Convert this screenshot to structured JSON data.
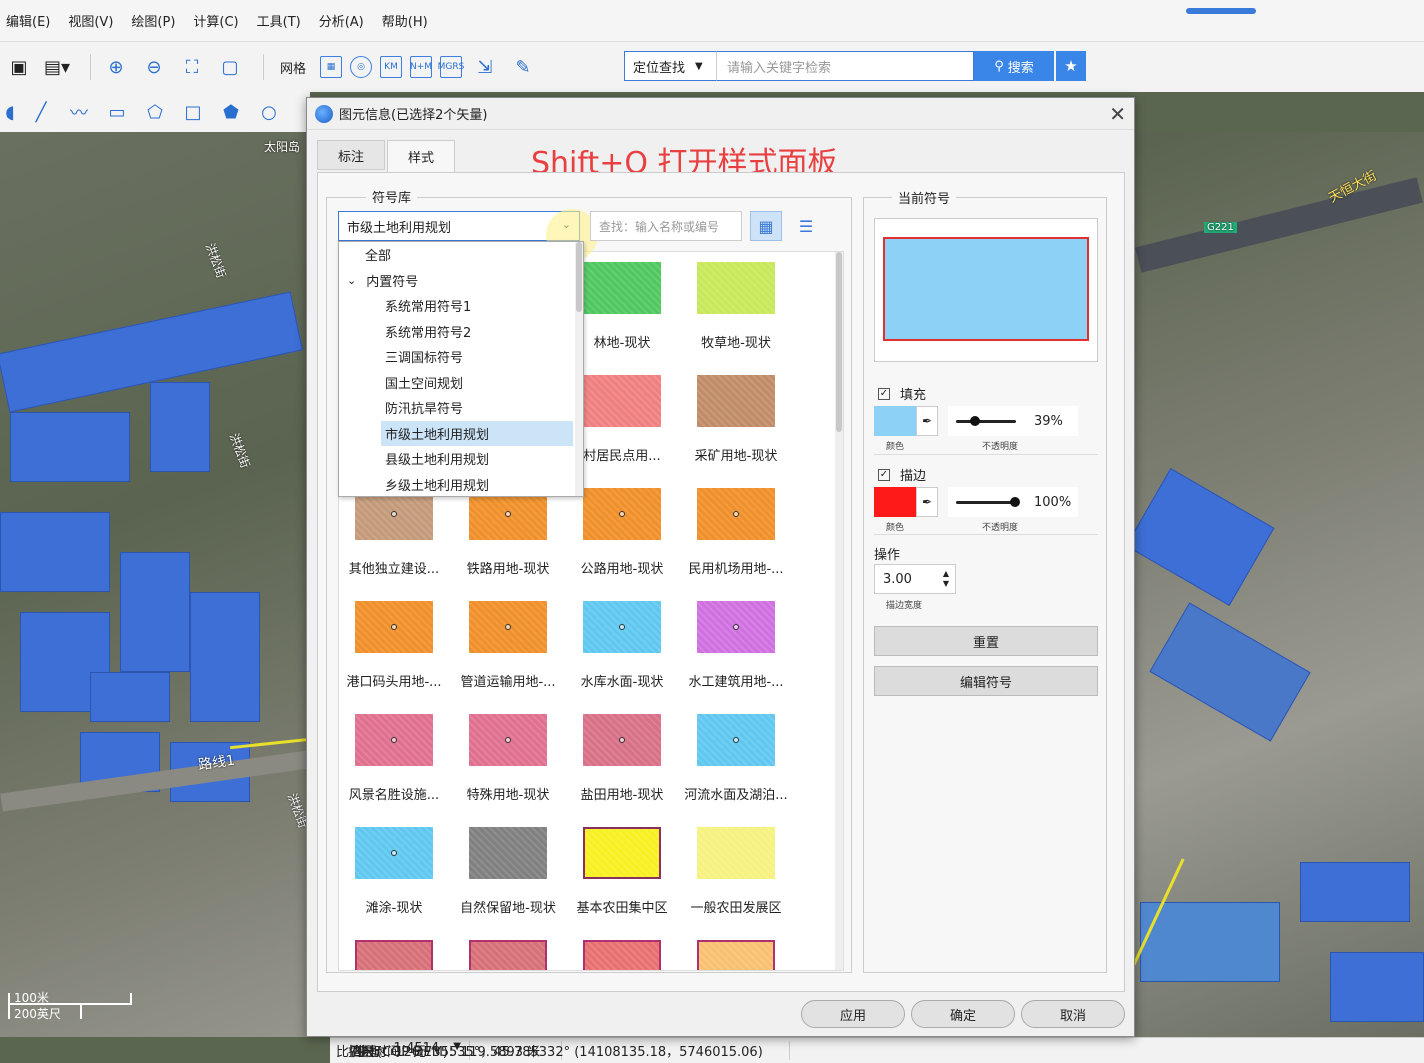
{
  "menubar": [
    "编辑(E)",
    "视图(V)",
    "绘图(P)",
    "计算(C)",
    "工具(T)",
    "分析(A)",
    "帮助(H)"
  ],
  "toolbar": {
    "grid_label": "网格",
    "grid_icons": [
      "▦",
      "◎",
      "KM",
      "N+M",
      "MGRS"
    ],
    "search_mode": "定位查找",
    "search_placeholder": "请输入关键字检索",
    "search_button": "搜索"
  },
  "map": {
    "labels": [
      "太阳岛",
      "洪松街",
      "洪松街",
      "洪松街",
      "路线1",
      "天恒大街",
      "G221"
    ],
    "scale_top": "100米",
    "scale_bottom": "200英尺"
  },
  "dialog": {
    "title": "图元信息(已选择2个矢量)",
    "tabs": [
      "标注",
      "样式"
    ],
    "annotation": "Shift+O 打开样式面板",
    "library_legend": "符号库",
    "library_selected": "市级土地利用规划",
    "find_placeholder": "查找：输入名称或编号",
    "dropdown": [
      {
        "label": "全部",
        "indent": 0,
        "selected": false,
        "arrow": false
      },
      {
        "label": "内置符号",
        "indent": 1,
        "selected": false,
        "arrow": true
      },
      {
        "label": "系统常用符号1",
        "indent": 2,
        "selected": false,
        "arrow": false
      },
      {
        "label": "系统常用符号2",
        "indent": 2,
        "selected": false,
        "arrow": false
      },
      {
        "label": "三调国标符号",
        "indent": 2,
        "selected": false,
        "arrow": false
      },
      {
        "label": "国土空间规划",
        "indent": 2,
        "selected": false,
        "arrow": false
      },
      {
        "label": "防汛抗旱符号",
        "indent": 2,
        "selected": false,
        "arrow": false
      },
      {
        "label": "市级土地利用规划",
        "indent": 2,
        "selected": true,
        "arrow": false
      },
      {
        "label": "县级土地利用规划",
        "indent": 2,
        "selected": false,
        "arrow": false
      },
      {
        "label": "乡级土地利用规划",
        "indent": 2,
        "selected": false,
        "arrow": false
      }
    ],
    "symbols": [
      {
        "label": "",
        "color": "#5fbf4f",
        "row": 0,
        "col": 0
      },
      {
        "label": "",
        "color": "#5fbf4f",
        "row": 0,
        "col": 1
      },
      {
        "label": "林地-现状",
        "color": "#4fc860",
        "row": 0,
        "col": 2
      },
      {
        "label": "牧草地-现状",
        "color": "#c8e85a",
        "row": 0,
        "col": 3
      },
      {
        "label": "",
        "color": "#f08080",
        "row": 1,
        "col": 0
      },
      {
        "label": "",
        "color": "#f08080",
        "row": 1,
        "col": 1
      },
      {
        "label": "村居民点用...",
        "color": "#f08080",
        "row": 1,
        "col": 2
      },
      {
        "label": "采矿用地-现状",
        "color": "#c08c68",
        "row": 1,
        "col": 3
      },
      {
        "label": "其他独立建设...",
        "color": "#c49a7a",
        "row": 2,
        "col": 0
      },
      {
        "label": "铁路用地-现状",
        "color": "#f0902a",
        "row": 2,
        "col": 1
      },
      {
        "label": "公路用地-现状",
        "color": "#f0902a",
        "row": 2,
        "col": 2
      },
      {
        "label": "民用机场用地-...",
        "color": "#f0902a",
        "row": 2,
        "col": 3
      },
      {
        "label": "港口码头用地-...",
        "color": "#f0902a",
        "row": 3,
        "col": 0
      },
      {
        "label": "管道运输用地-...",
        "color": "#f0902a",
        "row": 3,
        "col": 1
      },
      {
        "label": "水库水面-现状",
        "color": "#60c8f0",
        "row": 3,
        "col": 2
      },
      {
        "label": "水工建筑用地-...",
        "color": "#d070e0",
        "row": 3,
        "col": 3
      },
      {
        "label": "风景名胜设施...",
        "color": "#e07090",
        "row": 4,
        "col": 0
      },
      {
        "label": "特殊用地-现状",
        "color": "#e07090",
        "row": 4,
        "col": 1
      },
      {
        "label": "盐田用地-现状",
        "color": "#d87088",
        "row": 4,
        "col": 2
      },
      {
        "label": "河流水面及湖泊...",
        "color": "#60c8f0",
        "row": 4,
        "col": 3
      },
      {
        "label": "滩涂-现状",
        "color": "#60c8f0",
        "row": 5,
        "col": 0
      },
      {
        "label": "自然保留地-现状",
        "color": "#808080",
        "row": 5,
        "col": 1
      },
      {
        "label": "基本农田集中区",
        "color": "#f8f020",
        "row": 5,
        "col": 2
      },
      {
        "label": "一般农田发展区",
        "color": "#f6f280",
        "row": 5,
        "col": 3
      },
      {
        "label": "",
        "color": "#d87078",
        "row": 6,
        "col": 0
      },
      {
        "label": "",
        "color": "#d87078",
        "row": 6,
        "col": 1
      },
      {
        "label": "",
        "color": "#e87070",
        "row": 6,
        "col": 2
      },
      {
        "label": "",
        "color": "#f8c070",
        "row": 6,
        "col": 3
      }
    ],
    "current": {
      "legend": "当前符号",
      "fill_label": "填充",
      "fill_color": "#8dd1f7",
      "fill_opacity": "39%",
      "stroke_label": "描边",
      "stroke_color": "#ff1a1a",
      "stroke_opacity": "100%",
      "color_sub": "颜色",
      "opacity_sub": "不透明度",
      "operation_label": "操作",
      "width_value": "3.00",
      "width_sub": "描边宽度",
      "reset_button": "重置",
      "edit_button": "编辑符号"
    },
    "buttons": {
      "apply": "应用",
      "ok": "确定",
      "cancel": "取消"
    }
  },
  "status": {
    "scale_label": "比例尺:",
    "scale_value": "1:4514",
    "elevation": "高程(COP-DEM)：119.5893 米",
    "coords": "坐标：126.735535°，45.785332°  (14108135.18，5746015.06)",
    "capture_time": "拍摄时间：无"
  }
}
